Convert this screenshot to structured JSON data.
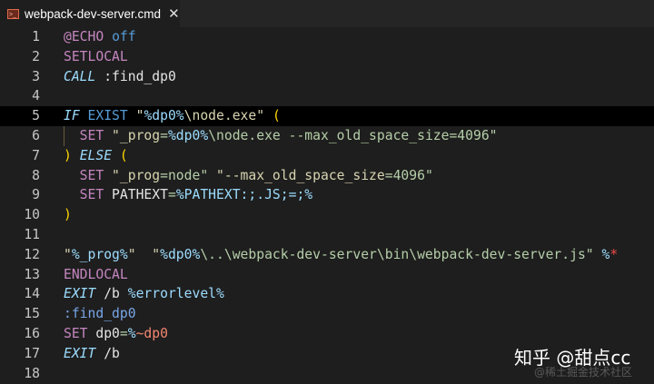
{
  "tab": {
    "title": "webpack-dev-server.cmd",
    "icon": "terminal-file-icon",
    "close": "✕"
  },
  "highlighted_line": 5,
  "lines": [
    {
      "n": "1",
      "tokens": [
        [
          "@ECHO",
          "kw"
        ],
        [
          " ",
          "tx"
        ],
        [
          "off",
          "bl"
        ]
      ]
    },
    {
      "n": "2",
      "tokens": [
        [
          "SETLOCAL",
          "kw"
        ]
      ]
    },
    {
      "n": "3",
      "tokens": [
        [
          "CALL",
          "it"
        ],
        [
          " :find_dp0",
          "tx"
        ]
      ]
    },
    {
      "n": "4",
      "tokens": []
    },
    {
      "n": "5",
      "tokens": [
        [
          "IF",
          "it"
        ],
        [
          " ",
          "tx"
        ],
        [
          "EXIST",
          "bl"
        ],
        [
          " \"",
          "st"
        ],
        [
          "%dp0%",
          "var"
        ],
        [
          "\\node.exe\" ",
          "st"
        ],
        [
          "(",
          "par"
        ]
      ]
    },
    {
      "n": "6",
      "tokens": [
        [
          "  SET",
          "kw"
        ],
        [
          " \"_prog",
          "st"
        ],
        [
          "=",
          "eq"
        ],
        [
          "%dp0%",
          "var"
        ],
        [
          "\\node.exe --max_old_space_size=4096\"",
          "gr"
        ]
      ]
    },
    {
      "n": "7",
      "tokens": [
        [
          ")",
          "par"
        ],
        [
          " ",
          "tx"
        ],
        [
          "ELSE",
          "it"
        ],
        [
          " ",
          "tx"
        ],
        [
          "(",
          "par"
        ]
      ]
    },
    {
      "n": "8",
      "tokens": [
        [
          "  SET",
          "kw"
        ],
        [
          " \"_prog",
          "st"
        ],
        [
          "=",
          "eq"
        ],
        [
          "node\"",
          "gr"
        ],
        [
          " \"--max_old_space_size",
          "st"
        ],
        [
          "=",
          "eq"
        ],
        [
          "4096\"",
          "gr"
        ]
      ]
    },
    {
      "n": "9",
      "tokens": [
        [
          "  SET",
          "kw"
        ],
        [
          " PATHEXT",
          "tx"
        ],
        [
          "=",
          "eq"
        ],
        [
          "%PATHEXT:;.JS;=;%",
          "var"
        ]
      ]
    },
    {
      "n": "10",
      "tokens": [
        [
          ")",
          "par"
        ]
      ]
    },
    {
      "n": "11",
      "tokens": []
    },
    {
      "n": "12",
      "tokens": [
        [
          "\"",
          "st"
        ],
        [
          "%_prog%",
          "var"
        ],
        [
          "\"  \"",
          "st"
        ],
        [
          "%dp0%",
          "var"
        ],
        [
          "\\..\\webpack-dev-server\\bin\\webpack-dev-server.js\" ",
          "gr"
        ],
        [
          "%",
          "var"
        ],
        [
          "*",
          "red"
        ]
      ]
    },
    {
      "n": "13",
      "tokens": [
        [
          "ENDLOCAL",
          "kw"
        ]
      ]
    },
    {
      "n": "14",
      "tokens": [
        [
          "EXIT",
          "it"
        ],
        [
          " /b ",
          "tx"
        ],
        [
          "%errorlevel%",
          "var"
        ]
      ]
    },
    {
      "n": "15",
      "tokens": [
        [
          ":find_dp0",
          "lbl"
        ]
      ]
    },
    {
      "n": "16",
      "tokens": [
        [
          "SET",
          "kw"
        ],
        [
          " dp0",
          "tx"
        ],
        [
          "=",
          "eq"
        ],
        [
          "%",
          "var"
        ],
        [
          "~dp0",
          "or"
        ]
      ]
    },
    {
      "n": "17",
      "tokens": [
        [
          "EXIT",
          "it"
        ],
        [
          " /b",
          "tx"
        ]
      ]
    },
    {
      "n": "18",
      "tokens": []
    }
  ],
  "watermark": {
    "text": "知乎 @甜点cc",
    "subtext": "@稀土掘金技术社区"
  }
}
